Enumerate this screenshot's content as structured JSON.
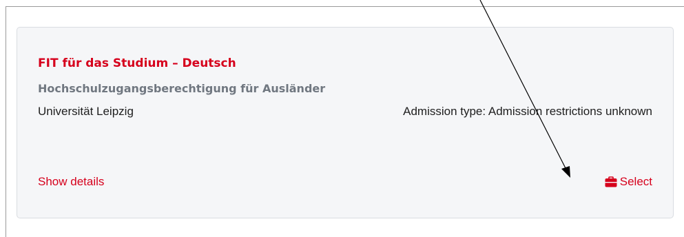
{
  "card": {
    "title": "FIT für das Studium – Deutsch",
    "subtitle": "Hochschulzugangsberechtigung für Ausländer",
    "university": "Universität Leipzig",
    "admission_type": "Admission type: Admission restrictions unknown",
    "show_details_label": "Show details",
    "select_label": "Select",
    "select_icon": "briefcase-icon"
  },
  "colors": {
    "accent": "#d6001c",
    "subtitle": "#707780",
    "card_background": "#f5f6f8"
  }
}
